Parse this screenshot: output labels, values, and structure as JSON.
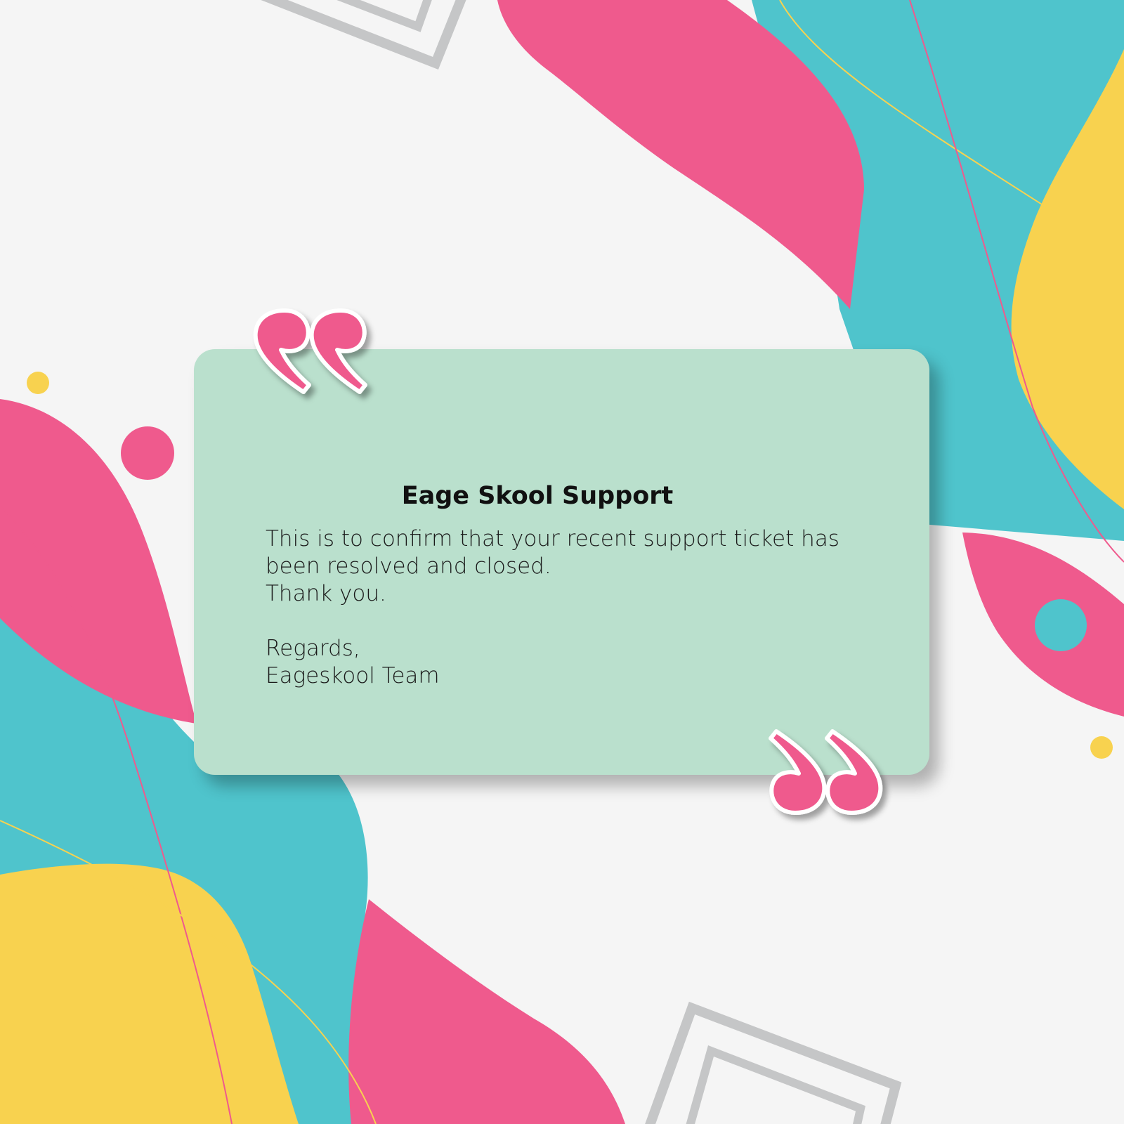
{
  "colors": {
    "background": "#f5f5f5",
    "pink": "#ef5a8d",
    "teal": "#4fc4cc",
    "yellow": "#f8d24f",
    "card": "#bae0cd",
    "outline_gray": "#c5c6c7"
  },
  "card": {
    "title": "Eage Skool Support",
    "message_line1": "This is to confirm that your recent support ticket has",
    "message_line2": "been resolved and closed.",
    "thanks": "Thank you.",
    "regards": "Regards,",
    "signature": "Eageskool Team"
  },
  "icons": {
    "open_quote": "opening-quote-icon",
    "close_quote": "closing-quote-icon"
  }
}
